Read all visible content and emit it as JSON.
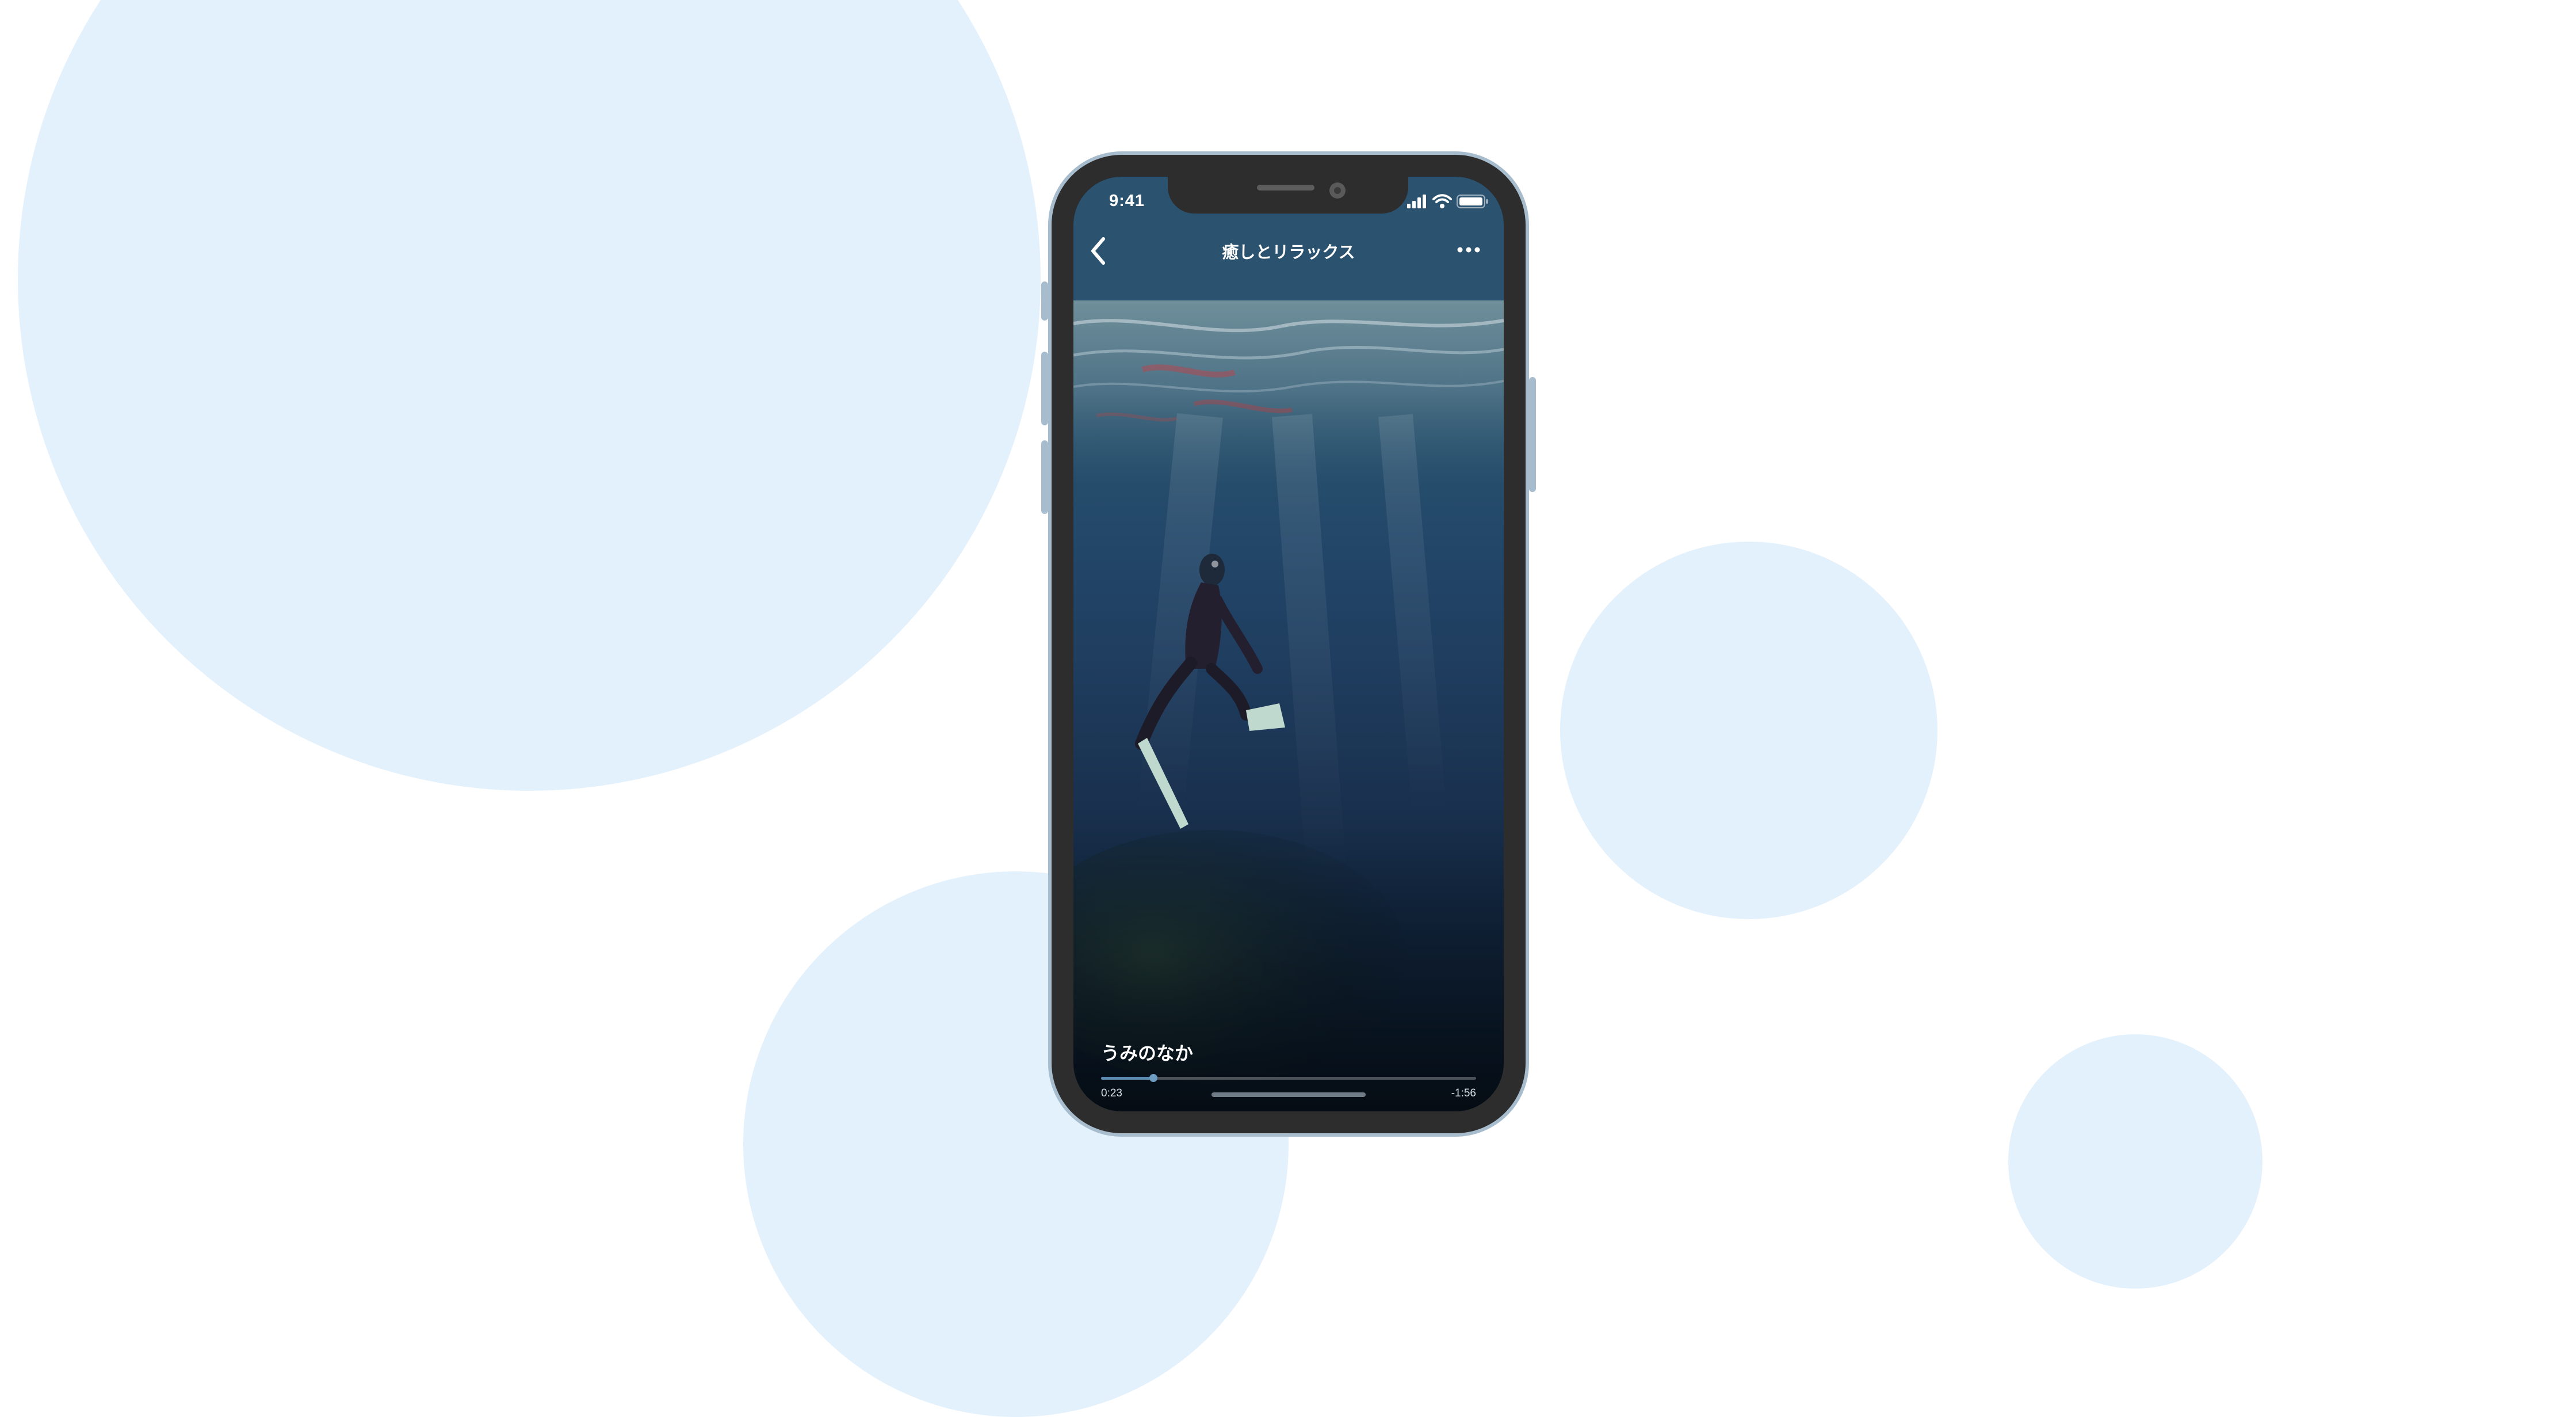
{
  "status_bar": {
    "time": "9:41"
  },
  "nav": {
    "title": "癒しとリラックス"
  },
  "player": {
    "track_title": "うみのなか",
    "elapsed": "0:23",
    "remaining": "-1:56",
    "progress_fraction": 0.14
  },
  "colors": {
    "background": "#ffffff",
    "bg_circle": "#e3f1fd",
    "phone_frame": "#a7bccd",
    "header": "#2b536f",
    "progress_accent": "#5b8bb0"
  },
  "icons": [
    "signal-icon",
    "wifi-icon",
    "battery-icon",
    "back-chevron-icon",
    "more-icon",
    "previous-track-icon",
    "play-icon",
    "next-track-icon"
  ]
}
